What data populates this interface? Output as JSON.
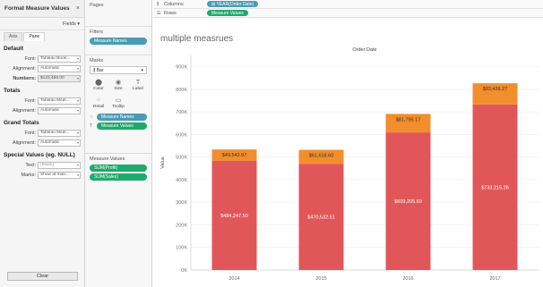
{
  "format_pane": {
    "title": "Format Measure Values",
    "close": "×",
    "fields_label": "Fields ▾",
    "tabs": [
      "Axis",
      "Pane"
    ],
    "sections": [
      {
        "title": "Default",
        "rows": [
          {
            "label": "Font:",
            "value": "Tableau Book...",
            "bold": false
          },
          {
            "label": "Alignment:",
            "value": "Automatic",
            "bold": false
          },
          {
            "label": "Numbers:",
            "value": "$123,456.00",
            "bold": true
          }
        ]
      },
      {
        "title": "Totals",
        "rows": [
          {
            "label": "Font:",
            "value": "Tableau Medi...",
            "bold": false
          },
          {
            "label": "Alignment:",
            "value": "Automatic",
            "bold": false
          }
        ]
      },
      {
        "title": "Grand Totals",
        "rows": [
          {
            "label": "Font:",
            "value": "Tableau Medi...",
            "bold": false
          },
          {
            "label": "Alignment:",
            "value": "Automatic",
            "bold": false
          }
        ]
      },
      {
        "title": "Special Values (eg. NULL)",
        "rows": [
          {
            "label": "Text:",
            "value": "(Blank)",
            "bold": false,
            "placeholder": true
          },
          {
            "label": "Marks:",
            "value": "Show at Indic...",
            "bold": false
          }
        ]
      }
    ],
    "clear_label": "Clear"
  },
  "shelves": {
    "pages_label": "Pages",
    "filters_label": "Filters",
    "filter_pill": "Measure Names",
    "marks_label": "Marks",
    "mark_type": "Bar",
    "mark_buttons": [
      {
        "name": "color",
        "icon": "⬤",
        "label": "Color"
      },
      {
        "name": "size",
        "icon": "◉",
        "label": "Size"
      },
      {
        "name": "label",
        "icon": "T",
        "label": "Label"
      },
      {
        "name": "detail",
        "icon": "⁘",
        "label": "Detail"
      },
      {
        "name": "tooltip",
        "icon": "▭",
        "label": "Tooltip"
      }
    ],
    "mark_fields": [
      {
        "icon": "⁘",
        "label": "Measure Names",
        "color": "blue"
      },
      {
        "icon": "T",
        "label": "Measure Values",
        "color": "green"
      }
    ],
    "measure_values_label": "Measure Values",
    "measure_values": [
      "SUM(Profit)",
      "SUM(Sales)"
    ],
    "columns_label": "Columns",
    "columns_pill": "⊞ YEAR(Order Date)",
    "rows_label": "Rows",
    "rows_pill": "Measure Values"
  },
  "viz": {
    "title": "multiple measrues"
  },
  "colors": {
    "sales": "#e15759",
    "profit": "#f28e2b",
    "pill_blue": "#4a9bb5",
    "pill_green": "#1eaa6c"
  },
  "chart_data": {
    "type": "bar",
    "stacked": true,
    "header": "Order Date",
    "xlabel": "",
    "ylabel": "Value",
    "categories": [
      "2014",
      "2015",
      "2016",
      "2017"
    ],
    "series": [
      {
        "values": [
          484247.5,
          470532.51,
          609205.6,
          733215.26
        ],
        "labels": [
          "$484,247.50",
          "$470,532.51",
          "$609,205.60",
          "$733,215.26"
        ],
        "color": "#e15759"
      },
      {
        "values": [
          49543.97,
          61618.6,
          81795.17,
          93439.27
        ],
        "labels": [
          "$49,543.97",
          "$61,618.60",
          "$81,795.17",
          "$93,439.27"
        ],
        "color": "#f28e2b"
      }
    ],
    "ylim": [
      0,
      950000
    ],
    "yticks": [
      0,
      100000,
      200000,
      300000,
      400000,
      500000,
      600000,
      700000,
      800000,
      900000
    ],
    "ytick_labels": [
      "0K",
      "100K",
      "200K",
      "300K",
      "400K",
      "500K",
      "600K",
      "700K",
      "800K",
      "900K"
    ],
    "grid": true
  }
}
